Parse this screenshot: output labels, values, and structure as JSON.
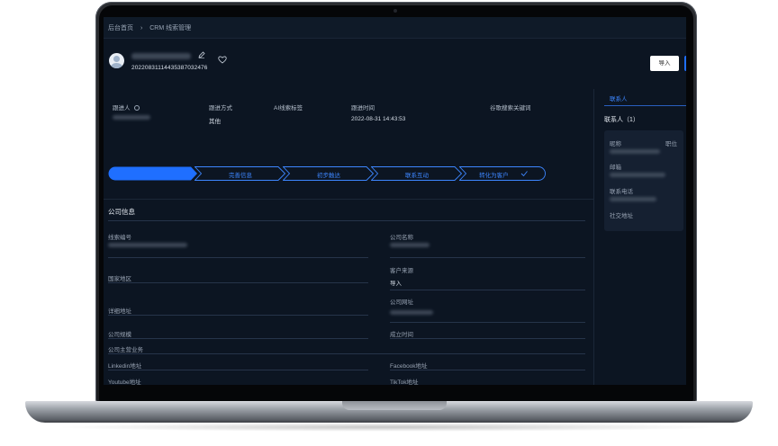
{
  "breadcrumb": {
    "home": "后台首页",
    "separator": "›",
    "current": "CRM 线索管理"
  },
  "header": {
    "lead_id": "20220831114435387032476",
    "import_label": "导入"
  },
  "top_fields": {
    "follower_label": "跟进人",
    "method_label": "跟进方式",
    "method_value": "其他",
    "ai_tag_label": "AI线索标签",
    "time_label": "跟进时间",
    "time_value": "2022-08-31 14:43:53",
    "keyword_label": "谷歌搜索关键词"
  },
  "steps": [
    "完善信息",
    "初步触达",
    "联系互动",
    "转化为客户"
  ],
  "company": {
    "title": "公司信息",
    "lead_no_label": "线索编号",
    "company_name_label": "公司名称",
    "region_label": "国家地区",
    "source_label": "客户来源",
    "source_value": "导入",
    "address_label": "详细地址",
    "website_label": "公司网址",
    "scale_label": "公司规模",
    "founded_label": "成立时间",
    "business_label": "公司主营业务",
    "linkedin_label": "Linkedin地址",
    "facebook_label": "Facebook地址",
    "youtube_label": "Youtube地址",
    "tiktok_label": "TikTok地址"
  },
  "side": {
    "tab_label": "联系人",
    "contacts_title": "联系人（1）",
    "nickname_label": "昵称",
    "position_label": "职位",
    "email_label": "邮箱",
    "phone_label": "联系电话",
    "social_label": "社交地址"
  },
  "colors": {
    "screen_bg": "#0c1522",
    "accent": "#1f6fff",
    "step_outline": "#3d86ff"
  }
}
